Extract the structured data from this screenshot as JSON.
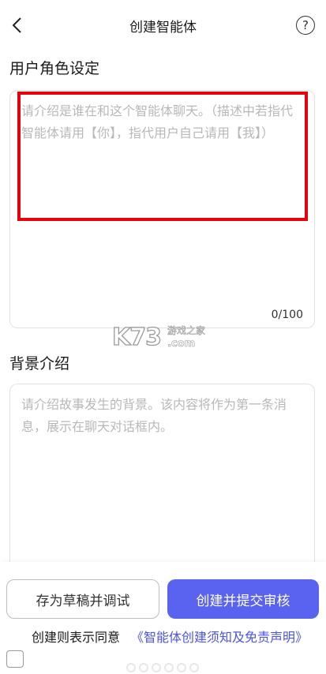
{
  "header": {
    "title": "创建智能体",
    "back_icon": "chevron-left-icon",
    "help_icon": "question-circle-icon",
    "help_glyph": "?"
  },
  "role_section": {
    "label": "用户角色设定",
    "placeholder": "请介绍是谁在和这个智能体聊天。（描述中若指代智能体请用【你】，指代用户自己请用【我】）",
    "counter": "0/100"
  },
  "background_section": {
    "label": "背景介绍",
    "placeholder": "请介绍故事发生的背景。该内容将作为第一条消息，展示在聊天对话框内。"
  },
  "actions": {
    "draft_label": "存为草稿并调试",
    "submit_label": "创建并提交审核"
  },
  "agreement": {
    "text": "创建则表示同意",
    "link": "《智能体创建须知及免责声明》"
  },
  "watermark": {
    "logo": "K73",
    "cn": "游戏之家",
    "com": ".com"
  },
  "colors": {
    "accent": "#5a63f0",
    "link": "#4a55e0",
    "highlight_frame": "#e8000b",
    "placeholder": "#b8b8b8"
  }
}
